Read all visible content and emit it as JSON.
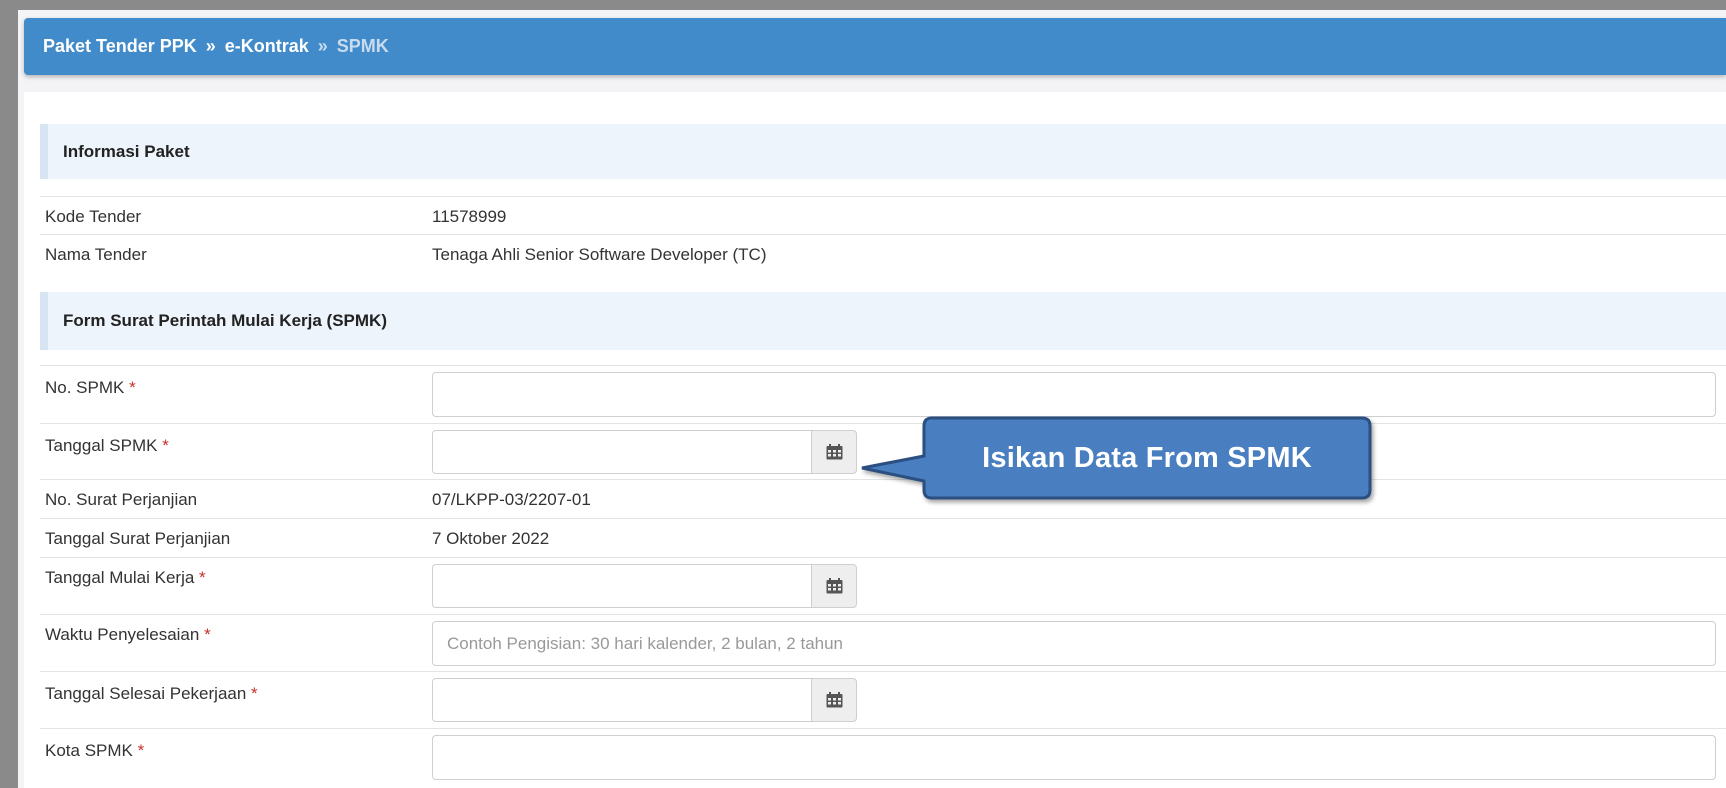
{
  "breadcrumb": {
    "items": [
      "Paket Tender PPK",
      "e-Kontrak",
      "SPMK"
    ],
    "separator": "»"
  },
  "sections": {
    "info": "Informasi Paket",
    "form": "Form Surat Perintah Mulai Kerja (SPMK)"
  },
  "info": {
    "kode_label": "Kode Tender",
    "kode_value": "11578999",
    "nama_label": "Nama Tender",
    "nama_value": "Tenaga Ahli Senior Software Developer (TC)"
  },
  "form": {
    "required_mark": "*",
    "no_spmk_label": "No. SPMK",
    "no_spmk_value": "",
    "tanggal_spmk_label": "Tanggal SPMK",
    "tanggal_spmk_value": "",
    "no_surat_label": "No. Surat Perjanjian",
    "no_surat_value": "07/LKPP-03/2207-01",
    "tanggal_surat_label": "Tanggal Surat Perjanjian",
    "tanggal_surat_value": "7 Oktober 2022",
    "tanggal_mulai_label": "Tanggal Mulai Kerja",
    "tanggal_mulai_value": "",
    "waktu_label": "Waktu Penyelesaian",
    "waktu_placeholder": "Contoh Pengisian: 30 hari kalender, 2 bulan, 2 tahun",
    "tanggal_selesai_label": "Tanggal Selesai Pekerjaan",
    "tanggal_selesai_value": "",
    "kota_label": "Kota SPMK",
    "kota_value": ""
  },
  "callout": {
    "text": "Isikan Data From SPMK"
  },
  "icons": {
    "date_button": "calendar-icon"
  },
  "colors": {
    "header_bg": "#428bca",
    "section_bg": "#eef4fb",
    "required": "#c9302c",
    "callout_bg": "#4a7fc0",
    "callout_border": "#2c4f80"
  }
}
